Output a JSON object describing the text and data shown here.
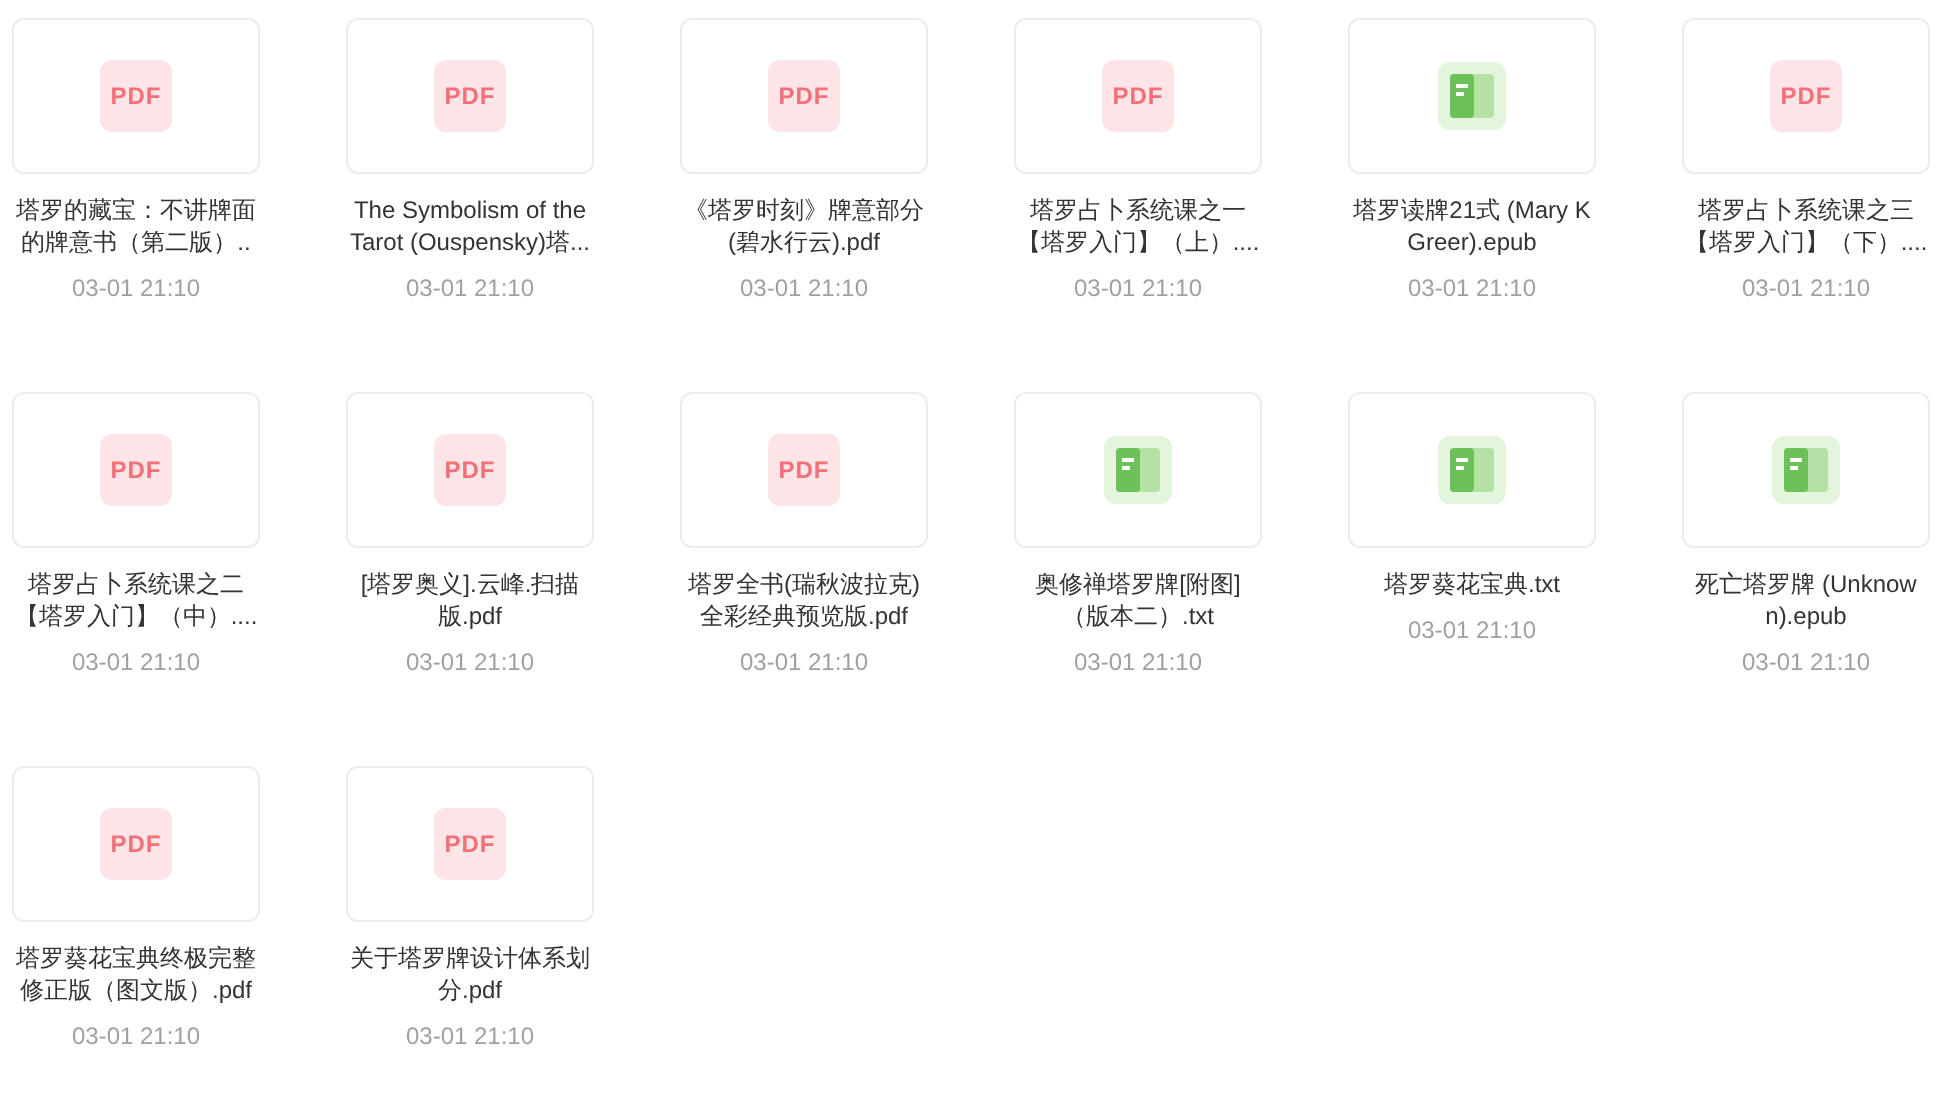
{
  "files": [
    {
      "kind": "pdf",
      "badge": "PDF",
      "name_lines": [
        "塔罗的藏宝：不讲牌面",
        "的牌意书（第二版）.."
      ],
      "date": "03-01 21:10"
    },
    {
      "kind": "pdf",
      "badge": "PDF",
      "name_lines": [
        "The Symbolism of the",
        "Tarot (Ouspensky)塔..."
      ],
      "date": "03-01 21:10"
    },
    {
      "kind": "pdf",
      "badge": "PDF",
      "name_lines": [
        "《塔罗时刻》牌意部分",
        "(碧水行云).pdf"
      ],
      "date": "03-01 21:10"
    },
    {
      "kind": "pdf",
      "badge": "PDF",
      "name_lines": [
        "塔罗占卜系统课之一",
        "【塔罗入门】（上）...."
      ],
      "date": "03-01 21:10"
    },
    {
      "kind": "book",
      "name_lines": [
        "塔罗读牌21式 (Mary K",
        "Greer).epub"
      ],
      "date": "03-01 21:10"
    },
    {
      "kind": "pdf",
      "badge": "PDF",
      "name_lines": [
        "塔罗占卜系统课之三",
        "【塔罗入门】（下）...."
      ],
      "date": "03-01 21:10"
    },
    {
      "kind": "pdf",
      "badge": "PDF",
      "name_lines": [
        "塔罗占卜系统课之二",
        "【塔罗入门】（中）...."
      ],
      "date": "03-01 21:10"
    },
    {
      "kind": "pdf",
      "badge": "PDF",
      "name_lines": [
        "[塔罗奥义].云峰.扫描",
        "版.pdf"
      ],
      "date": "03-01 21:10"
    },
    {
      "kind": "pdf",
      "badge": "PDF",
      "name_lines": [
        "塔罗全书(瑞秋波拉克)",
        "全彩经典预览版.pdf"
      ],
      "date": "03-01 21:10"
    },
    {
      "kind": "book",
      "name_lines": [
        "奥修禅塔罗牌[附图]",
        "（版本二）.txt"
      ],
      "date": "03-01 21:10"
    },
    {
      "kind": "book",
      "name_lines": [
        "塔罗葵花宝典.txt"
      ],
      "date": "03-01 21:10"
    },
    {
      "kind": "book",
      "name_lines": [
        "死亡塔罗牌 (Unknow",
        "n).epub"
      ],
      "date": "03-01 21:10"
    },
    {
      "kind": "pdf",
      "badge": "PDF",
      "name_lines": [
        "塔罗葵花宝典终极完整",
        "修正版（图文版）.pdf"
      ],
      "date": "03-01 21:10"
    },
    {
      "kind": "pdf",
      "badge": "PDF",
      "name_lines": [
        "关于塔罗牌设计体系划",
        "分.pdf"
      ],
      "date": "03-01 21:10"
    }
  ]
}
